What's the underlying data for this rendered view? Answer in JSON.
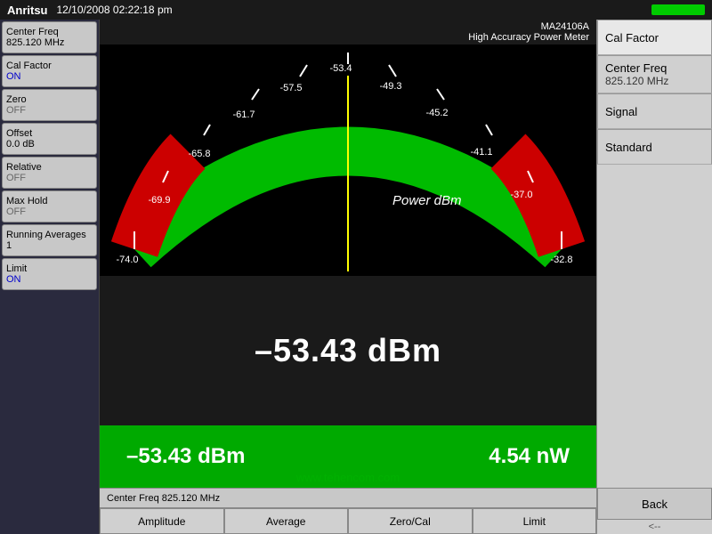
{
  "topbar": {
    "logo": "Anritsu",
    "datetime": "12/10/2008 02:22:18 pm",
    "indicator_label": "indicator"
  },
  "device": {
    "model": "MA24106A",
    "description": "High Accuracy Power Meter"
  },
  "sidebar_left": {
    "buttons": [
      {
        "label": "Center Freq",
        "value": "825.120 MHz"
      },
      {
        "label": "Cal Factor",
        "value": "ON",
        "state": "on"
      },
      {
        "label": "Zero",
        "value": "OFF",
        "state": "off"
      },
      {
        "label": "Offset",
        "value": "0.0 dB",
        "state": "neutral"
      },
      {
        "label": "Relative",
        "value": "OFF",
        "state": "off"
      },
      {
        "label": "Max Hold",
        "value": "OFF",
        "state": "off"
      },
      {
        "label": "Running Averages",
        "value": "1",
        "state": "neutral"
      },
      {
        "label": "Limit",
        "value": "ON",
        "state": "on"
      }
    ]
  },
  "gauge": {
    "scale_labels": [
      "-74.0",
      "-69.9",
      "-65.8",
      "-61.7",
      "-57.5",
      "-53.4",
      "-49.3",
      "-45.2",
      "-41.1",
      "-37.0",
      "-32.8"
    ],
    "needle_label": "Power dBm",
    "reading_large": "–53.43 dBm"
  },
  "bottom_bar": {
    "dbm_value": "–53.43 dBm",
    "nw_value": "4.54 nW",
    "watermark": "www.tehencom.com"
  },
  "status_bar": {
    "text": "Center Freq 825.120 MHz"
  },
  "right_sidebar": {
    "title": "Cal Factor",
    "items": [
      {
        "label": "Center Freq",
        "value": "825.120 MHz"
      },
      {
        "label": "Signal",
        "value": ""
      },
      {
        "label": "Standard",
        "value": ""
      }
    ],
    "back_label": "Back",
    "arrow": "<--"
  },
  "bottom_buttons": {
    "buttons": [
      "Amplitude",
      "Average",
      "Zero/Cal",
      "Limit"
    ]
  }
}
